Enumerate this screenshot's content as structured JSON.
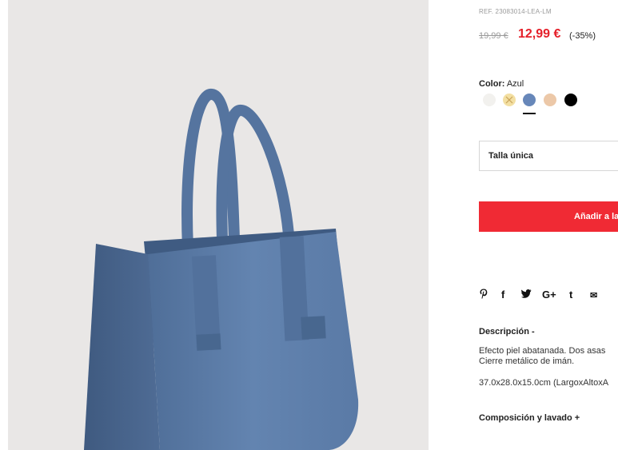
{
  "product": {
    "ref": "REF. 23083014-LEA-LM",
    "old_price": "19,99 €",
    "new_price": "12,99 €",
    "discount": "(-35%)",
    "color_label": "Color:",
    "color_value": "Azul",
    "swatches": [
      {
        "name": "white",
        "color": "#f2f1ee"
      },
      {
        "name": "yellow-crossed",
        "color": "#f3dfa2"
      },
      {
        "name": "blue",
        "color": "#6787b9"
      },
      {
        "name": "beige",
        "color": "#ecc8a8"
      },
      {
        "name": "black",
        "color": "#000000"
      }
    ],
    "size_label": "Talla única",
    "add_button_label": "Añadir a la",
    "share_icons": [
      {
        "name": "pinterest",
        "glyph": "𝓅"
      },
      {
        "name": "facebook",
        "glyph": "f"
      },
      {
        "name": "twitter",
        "glyph": "🐦"
      },
      {
        "name": "google-plus",
        "glyph": "G+"
      },
      {
        "name": "tumblr",
        "glyph": "t"
      },
      {
        "name": "email",
        "glyph": "✉"
      }
    ],
    "description_title": "Descripción -",
    "description_line1": "Efecto piel abatanada. Dos asas",
    "description_line2": "Cierre metálico de imán.",
    "dimensions": "37.0x28.0x15.0cm (LargoxAltoxA",
    "composition_title": "Composición y lavado +"
  },
  "colors": {
    "accent": "#e5202a",
    "button": "#f02a34",
    "bag": "#5b7aa4",
    "background": "#e9e7e6"
  }
}
